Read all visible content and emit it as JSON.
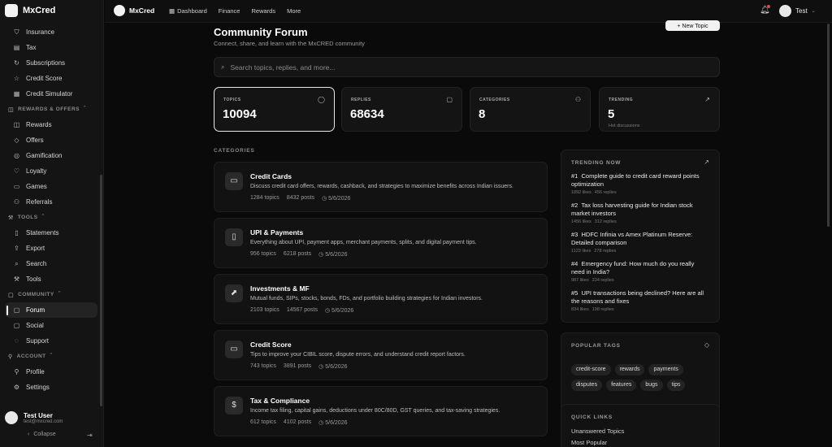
{
  "app": {
    "name": "MxCred"
  },
  "sidebar": {
    "brand": "MxCred",
    "items_top": [
      {
        "label": "Insurance",
        "icon": "shield-icon"
      },
      {
        "label": "Tax",
        "icon": "receipt-icon"
      },
      {
        "label": "Subscriptions",
        "icon": "refresh-icon"
      },
      {
        "label": "Credit Score",
        "icon": "star-icon"
      },
      {
        "label": "Credit Simulator",
        "icon": "calculator-icon"
      }
    ],
    "section_rewards": "REWARDS & OFFERS",
    "items_rewards": [
      {
        "label": "Rewards",
        "icon": "gift-icon"
      },
      {
        "label": "Offers",
        "icon": "tag-icon"
      },
      {
        "label": "Gamification",
        "icon": "target-icon"
      },
      {
        "label": "Loyalty",
        "icon": "heart-icon"
      },
      {
        "label": "Games",
        "icon": "gamepad-icon"
      },
      {
        "label": "Referrals",
        "icon": "users-icon"
      }
    ],
    "section_tools": "TOOLS",
    "items_tools": [
      {
        "label": "Statements",
        "icon": "file-icon"
      },
      {
        "label": "Export",
        "icon": "export-icon"
      },
      {
        "label": "Search",
        "icon": "search-icon"
      },
      {
        "label": "Tools",
        "icon": "wrench-icon"
      }
    ],
    "section_community": "COMMUNITY",
    "items_community": [
      {
        "label": "Forum",
        "icon": "chat-icon",
        "active": true
      },
      {
        "label": "Social",
        "icon": "share-icon"
      },
      {
        "label": "Support",
        "icon": "help-icon"
      }
    ],
    "section_account": "ACCOUNT",
    "items_account": [
      {
        "label": "Profile",
        "icon": "user-icon"
      },
      {
        "label": "Settings",
        "icon": "gear-icon"
      }
    ],
    "user": {
      "name": "Test User",
      "email": "test@mxcred.com"
    },
    "collapse_label": "Collapse"
  },
  "topbar": {
    "brand": "MxCred",
    "nav": [
      "Dashboard",
      "Finance",
      "Rewards",
      "More"
    ],
    "user_name": "Test"
  },
  "page": {
    "title": "Community Forum",
    "subtitle": "Connect, share, and learn with the MxCRED community",
    "new_topic": "+ New Topic",
    "search_placeholder": "Search topics, replies, and more..."
  },
  "stats": [
    {
      "label": "TOPICS",
      "value": "10094",
      "sub": ""
    },
    {
      "label": "REPLIES",
      "value": "68634",
      "sub": ""
    },
    {
      "label": "CATEGORIES",
      "value": "8",
      "sub": ""
    },
    {
      "label": "TRENDING",
      "value": "5",
      "sub": "Hot discussions"
    }
  ],
  "categories_heading": "CATEGORIES",
  "categories": [
    {
      "title": "Credit Cards",
      "desc": "Discuss credit card offers, rewards, cashback, and strategies to maximize benefits across Indian issuers.",
      "topics": "1284 topics",
      "posts": "8432 posts",
      "date": "5/6/2026",
      "icon": "credit-card-icon"
    },
    {
      "title": "UPI & Payments",
      "desc": "Everything about UPI, payment apps, merchant payments, splits, and digital payment tips.",
      "topics": "956 topics",
      "posts": "6218 posts",
      "date": "5/6/2026",
      "icon": "phone-icon"
    },
    {
      "title": "Investments & MF",
      "desc": "Mutual funds, SIPs, stocks, bonds, FDs, and portfolio building strategies for Indian investors.",
      "topics": "2103 topics",
      "posts": "14567 posts",
      "date": "5/6/2026",
      "icon": "chart-icon"
    },
    {
      "title": "Credit Score",
      "desc": "Tips to improve your CIBIL score, dispute errors, and understand credit report factors.",
      "topics": "743 topics",
      "posts": "3891 posts",
      "date": "5/6/2026",
      "icon": "laptop-icon"
    },
    {
      "title": "Tax & Compliance",
      "desc": "Income tax filing, capital gains, deductions under 80C/80D, GST queries, and tax-saving strategies.",
      "topics": "612 topics",
      "posts": "4102 posts",
      "date": "5/6/2026",
      "icon": "moneybag-icon"
    }
  ],
  "trending": {
    "title": "TRENDING NOW",
    "items": [
      {
        "rank": "#1",
        "title": "Complete guide to credit card reward points optimization",
        "likes": "1892 likes",
        "replies": "456 replies"
      },
      {
        "rank": "#2",
        "title": "Tax loss harvesting guide for Indian stock market investors",
        "likes": "1456 likes",
        "replies": "312 replies"
      },
      {
        "rank": "#3",
        "title": "HDFC Infinia vs Amex Platinum Reserve: Detailed comparison",
        "likes": "1123 likes",
        "replies": "278 replies"
      },
      {
        "rank": "#4",
        "title": "Emergency fund: How much do you really need in India?",
        "likes": "987 likes",
        "replies": "234 replies"
      },
      {
        "rank": "#5",
        "title": "UPI transactions being declined? Here are all the reasons and fixes",
        "likes": "834 likes",
        "replies": "198 replies"
      }
    ]
  },
  "popular_tags": {
    "title": "POPULAR TAGS",
    "tags": [
      "credit-score",
      "rewards",
      "payments",
      "disputes",
      "features",
      "bugs",
      "tips"
    ]
  },
  "quick_links": {
    "title": "QUICK LINKS",
    "links": [
      "Unanswered Topics",
      "Most Popular"
    ]
  }
}
